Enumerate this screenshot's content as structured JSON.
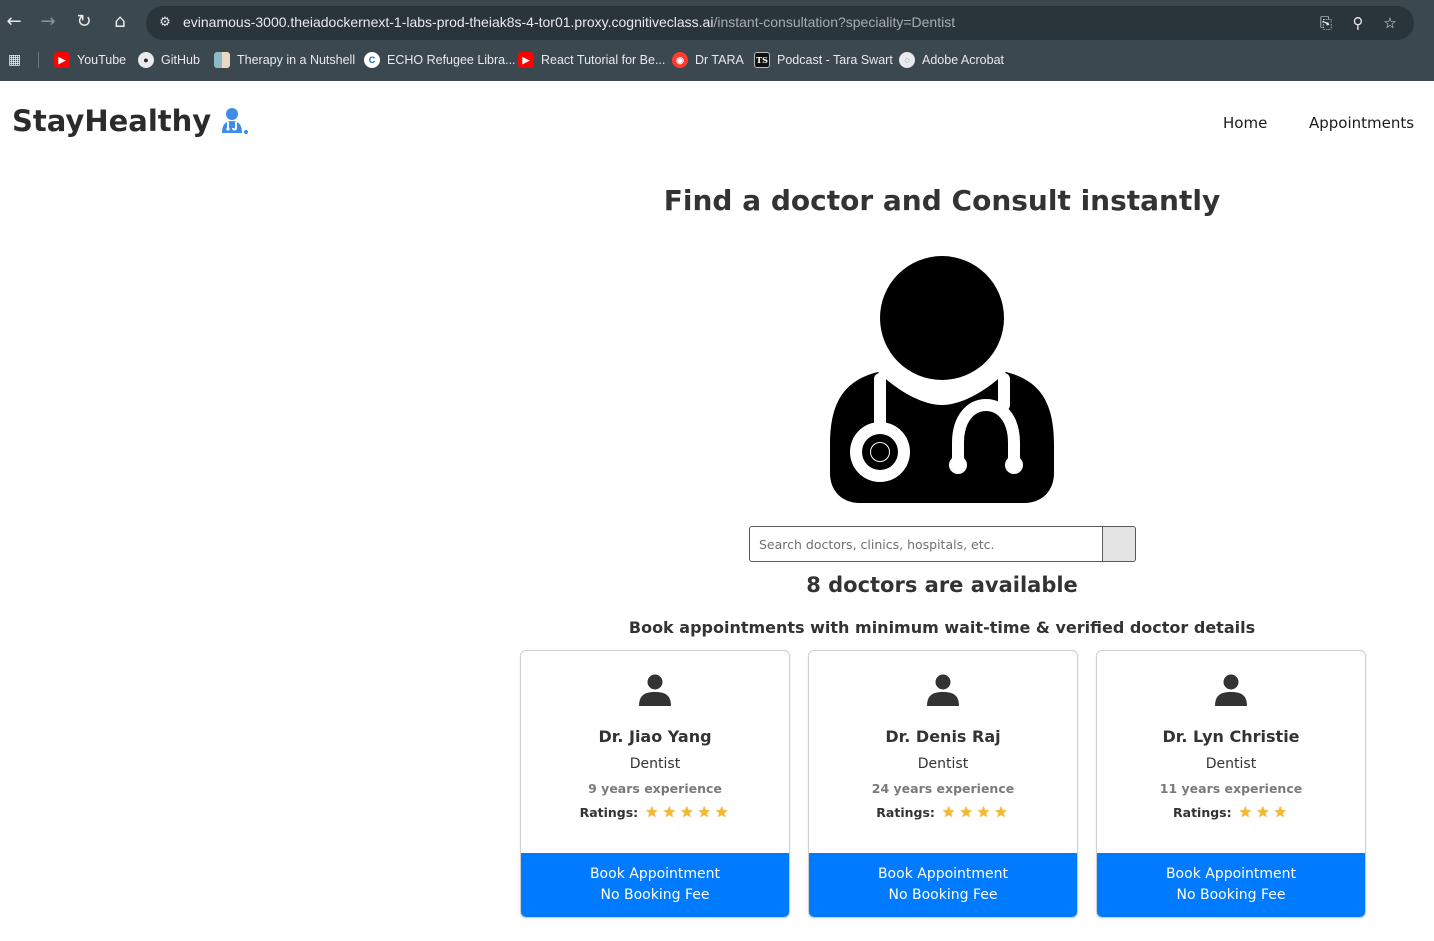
{
  "browser": {
    "url_host": "evinamous-3000.theiadockernext-1-labs-prod-theiak8s-4-tor01.proxy.cognitiveclass.ai",
    "url_path": "/instant-consultation?speciality=Dentist",
    "bookmarks": [
      {
        "label": "YouTube",
        "icon": "youtube-icon"
      },
      {
        "label": "GitHub",
        "icon": "github-icon"
      },
      {
        "label": "Therapy in a Nutshell",
        "icon": "therapy-icon"
      },
      {
        "label": "ECHO Refugee Libra...",
        "icon": "echo-icon"
      },
      {
        "label": "React Tutorial for Be...",
        "icon": "youtube-icon"
      },
      {
        "label": "Dr TARA",
        "icon": "tara-icon"
      },
      {
        "label": "Podcast - Tara Swart",
        "icon": "ts-icon"
      },
      {
        "label": "Adobe Acrobat",
        "icon": "acrobat-icon"
      }
    ],
    "ts_glyph": "TS"
  },
  "header": {
    "logo_text": "StayHealthy",
    "nav": [
      "Home",
      "Appointments"
    ]
  },
  "main": {
    "title": "Find a doctor and Consult instantly",
    "search_placeholder": "Search doctors, clinics, hospitals, etc.",
    "count_heading": "8 doctors are available",
    "sub_heading": "Book appointments with minimum wait-time & verified doctor details"
  },
  "doctors": [
    {
      "name": "Dr. Jiao Yang",
      "speciality": "Dentist",
      "experience": "9 years experience",
      "ratings_label": "Ratings:",
      "rating": 5,
      "button_line1": "Book Appointment",
      "button_line2": "No Booking Fee"
    },
    {
      "name": "Dr. Denis Raj",
      "speciality": "Dentist",
      "experience": "24 years experience",
      "ratings_label": "Ratings:",
      "rating": 4,
      "button_line1": "Book Appointment",
      "button_line2": "No Booking Fee"
    },
    {
      "name": "Dr. Lyn Christie",
      "speciality": "Dentist",
      "experience": "11 years experience",
      "ratings_label": "Ratings:",
      "rating": 3,
      "button_line1": "Book Appointment",
      "button_line2": "No Booking Fee"
    }
  ],
  "colors": {
    "chrome_bg": "#3c4850",
    "primary_button": "#007bff",
    "star": "#f5b82e",
    "logo_icon": "#3d8de6"
  }
}
